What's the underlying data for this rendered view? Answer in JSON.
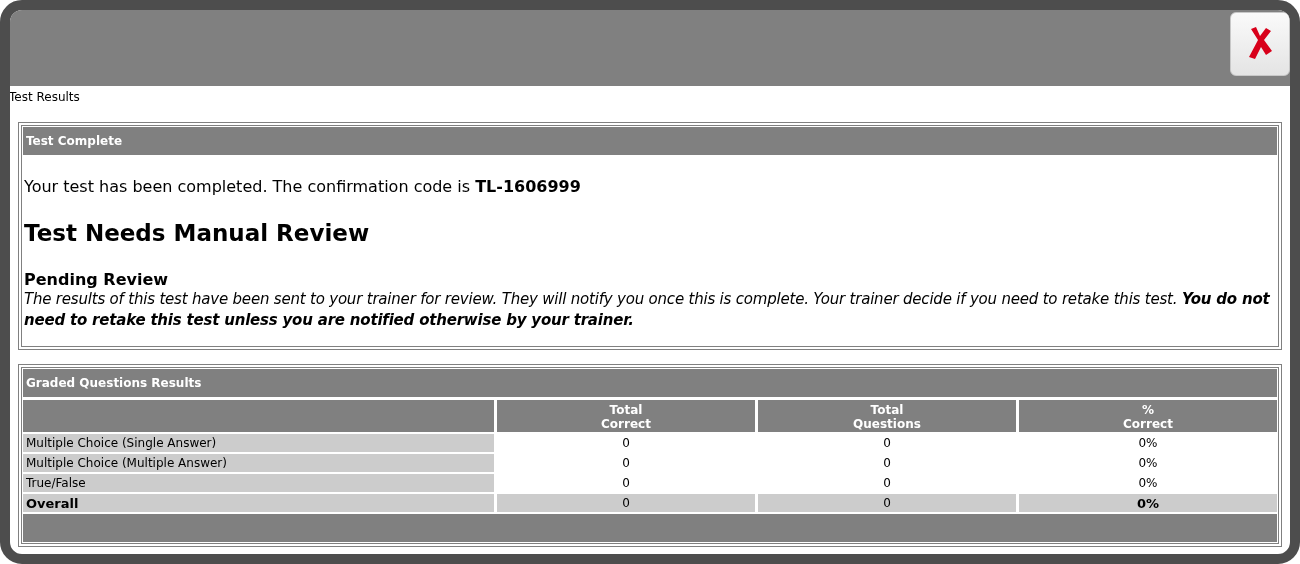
{
  "window": {
    "title": "Test Results"
  },
  "completion": {
    "heading": "Test Complete",
    "confirmation": "Your test has been completed. The confirmation code is **TL-1606999**",
    "status": "Test Needs Manual Review",
    "subheading": "Pending Review",
    "message": "The results of this test have been sent to your trainer for review. They will notify you once this is complete. Your trainer decide if you need to retake this test. **You do not need to retake this test unless you are notified otherwise by your trainer.**"
  },
  "results": {
    "heading": "Graded Questions Results",
    "columns": [
      "Total Correct",
      "Total Questions",
      "% Correct"
    ],
    "rows": [
      {
        "kind": "category",
        "label": "Multiple Choice (Single Answer)",
        "cells": [
          "0",
          "0",
          "0%"
        ]
      },
      {
        "kind": "category",
        "label": "Multiple Choice (Multiple Answer)",
        "cells": [
          "0",
          "0",
          "0%"
        ]
      },
      {
        "kind": "category",
        "label": "True/False",
        "cells": [
          "0",
          "0",
          "0%"
        ]
      },
      {
        "kind": "total",
        "label": "Overall",
        "cells": [
          "0",
          "0",
          "0%"
        ]
      }
    ]
  }
}
